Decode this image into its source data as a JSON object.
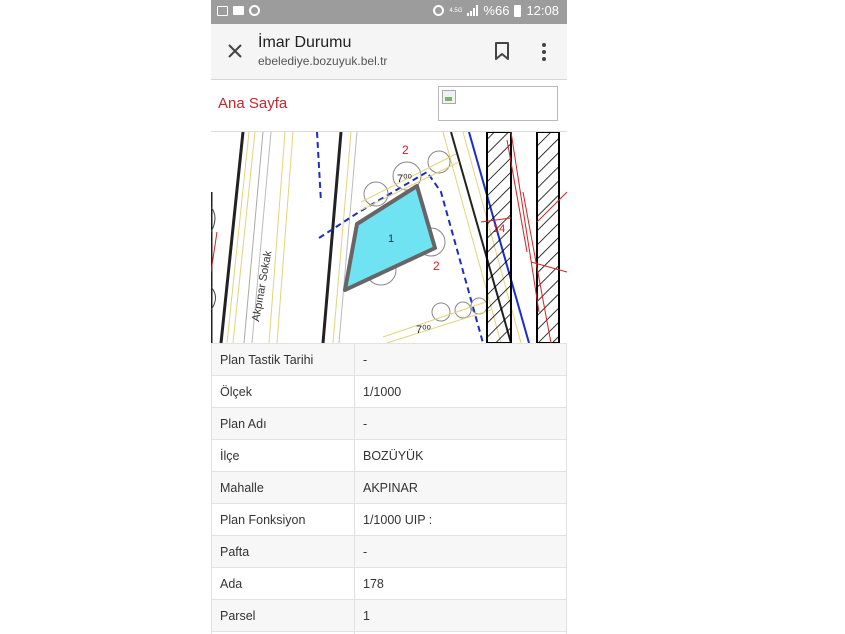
{
  "status_bar": {
    "battery_text": "%66",
    "time": "12:08",
    "network": "4.5G"
  },
  "toolbar": {
    "title": "İmar Durumu",
    "url": "ebelediye.bozuyuk.bel.tr"
  },
  "nav": {
    "home_link": "Ana Sayfa"
  },
  "map": {
    "street_label": "Akpınar Sokak",
    "parcel_number": "1",
    "label_top": "2",
    "label_right": "2",
    "label_far_right": "14",
    "road_width_top": "7⁰⁰",
    "road_width_bottom": "7⁰⁰",
    "parcel_fill_color": "#6fe3f2",
    "dash_color": "#1a2ccc",
    "accent_red": "#d62020"
  },
  "info_rows": [
    {
      "label": "Plan Tastik Tarihi",
      "value": "-"
    },
    {
      "label": "Ölçek",
      "value": "1/1000"
    },
    {
      "label": "Plan Adı",
      "value": "-"
    },
    {
      "label": "İlçe",
      "value": "BOZÜYÜK"
    },
    {
      "label": "Mahalle",
      "value": "AKPINAR"
    },
    {
      "label": "Plan Fonksiyon",
      "value": "1/1000 UIP :"
    },
    {
      "label": "Pafta",
      "value": "-"
    },
    {
      "label": "Ada",
      "value": "178"
    },
    {
      "label": "Parsel",
      "value": "1"
    }
  ]
}
